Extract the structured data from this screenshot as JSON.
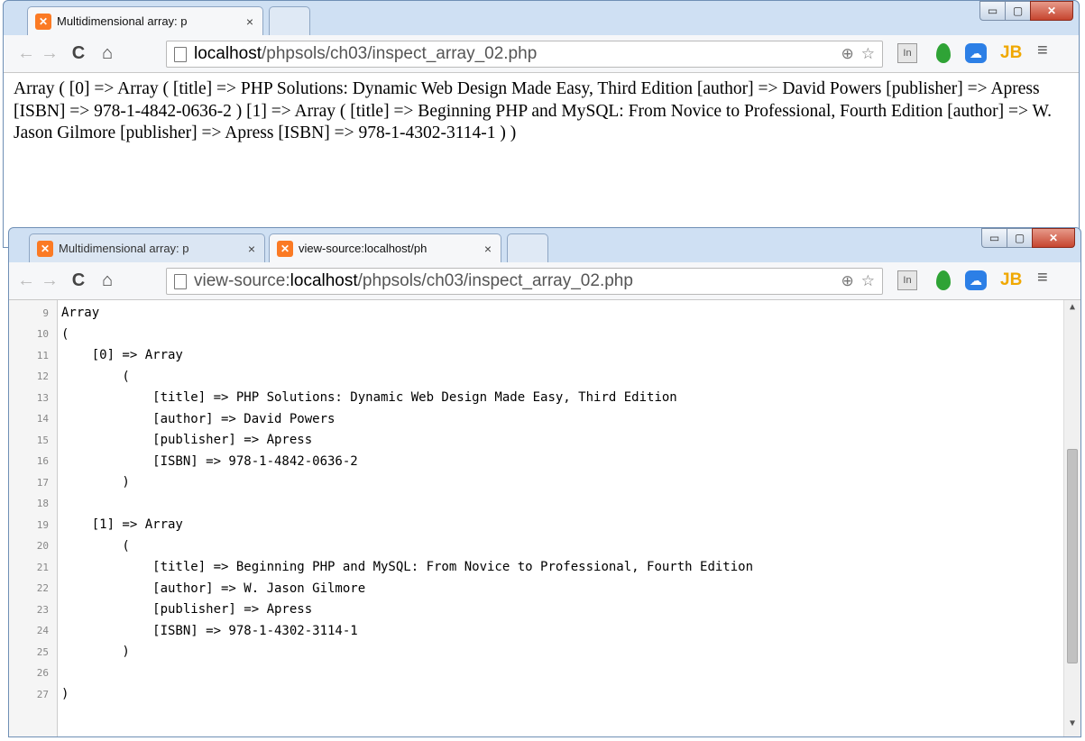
{
  "window1": {
    "tab_title": "Multidimensional array: p",
    "tab_close": "×",
    "url_host": "localhost",
    "url_path": "/phpsols/ch03/inspect_array_02.php",
    "print_r_output": "Array ( [0] => Array ( [title] => PHP Solutions: Dynamic Web Design Made Easy, Third Edition [author] => David Powers [publisher] => Apress [ISBN] => 978-1-4842-0636-2 ) [1] => Array ( [title] => Beginning PHP and MySQL: From Novice to Professional, Fourth Edition [author] => W. Jason Gilmore [publisher] => Apress [ISBN] => 978-1-4302-3114-1 ) )"
  },
  "window2": {
    "tab1_title": "Multidimensional array: p",
    "tab2_title": "view-source:localhost/ph",
    "tab_close": "×",
    "url_prefix": "view-source:",
    "url_host": "localhost",
    "url_path": "/phpsols/ch03/inspect_array_02.php",
    "source_lines": [
      {
        "num": "9",
        "text": "Array"
      },
      {
        "num": "10",
        "text": "("
      },
      {
        "num": "11",
        "text": "    [0] => Array"
      },
      {
        "num": "12",
        "text": "        ("
      },
      {
        "num": "13",
        "text": "            [title] => PHP Solutions: Dynamic Web Design Made Easy, Third Edition"
      },
      {
        "num": "14",
        "text": "            [author] => David Powers"
      },
      {
        "num": "15",
        "text": "            [publisher] => Apress"
      },
      {
        "num": "16",
        "text": "            [ISBN] => 978-1-4842-0636-2"
      },
      {
        "num": "17",
        "text": "        )"
      },
      {
        "num": "18",
        "text": ""
      },
      {
        "num": "19",
        "text": "    [1] => Array"
      },
      {
        "num": "20",
        "text": "        ("
      },
      {
        "num": "21",
        "text": "            [title] => Beginning PHP and MySQL: From Novice to Professional, Fourth Edition"
      },
      {
        "num": "22",
        "text": "            [author] => W. Jason Gilmore"
      },
      {
        "num": "23",
        "text": "            [publisher] => Apress"
      },
      {
        "num": "24",
        "text": "            [ISBN] => 978-1-4302-3114-1"
      },
      {
        "num": "25",
        "text": "        )"
      },
      {
        "num": "26",
        "text": ""
      },
      {
        "num": "27",
        "text": ")"
      }
    ]
  },
  "toolbar": {
    "back_icon": "←",
    "forward_icon": "→",
    "reload_icon": "C",
    "home_icon": "⌂",
    "zoom_icon": "⊕",
    "star_icon": "☆",
    "ext_in_label": "In",
    "ext_jb_label": "JB",
    "menu_icon": "≡"
  },
  "window_controls": {
    "minimize": "▭",
    "maximize": "▢",
    "close": "✕"
  }
}
